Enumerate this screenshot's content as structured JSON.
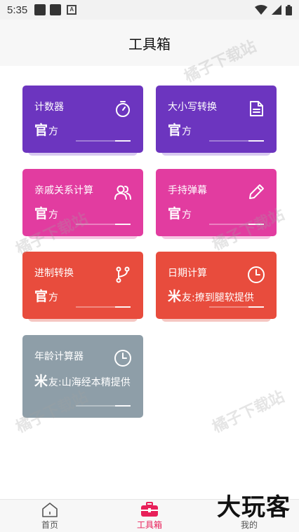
{
  "status": {
    "time": "5:35",
    "a_label": "A"
  },
  "header": {
    "title": "工具箱"
  },
  "tools": [
    {
      "title": "计数器",
      "sub_big": "官",
      "sub_rest": "方",
      "icon": "stopwatch-icon"
    },
    {
      "title": "大小写转换",
      "sub_big": "官",
      "sub_rest": "方",
      "icon": "document-icon"
    },
    {
      "title": "亲戚关系计算",
      "sub_big": "官",
      "sub_rest": "方",
      "icon": "people-icon"
    },
    {
      "title": "手持弹幕",
      "sub_big": "官",
      "sub_rest": "方",
      "icon": "pencil-icon"
    },
    {
      "title": "进制转换",
      "sub_big": "官",
      "sub_rest": "方",
      "icon": "branch-icon"
    },
    {
      "title": "日期计算",
      "sub_big": "米",
      "sub_rest": "友:撩到腿软提供",
      "icon": "clock-icon"
    },
    {
      "title": "年龄计算器",
      "sub_big": "米",
      "sub_rest": "友:山海经本精提供",
      "icon": "clock-icon"
    }
  ],
  "watermark": "橘子下载站",
  "nav": {
    "items": [
      {
        "label": "首页"
      },
      {
        "label": "工具箱"
      },
      {
        "label": "我的"
      }
    ]
  },
  "brand": "大玩客",
  "colors": {
    "purple": "#6c35bf",
    "pink": "#e23ca0",
    "red": "#e84c3d",
    "grey": "#8e9ea8",
    "nav_active": "#e8205a"
  }
}
